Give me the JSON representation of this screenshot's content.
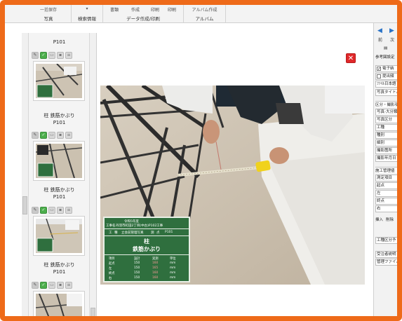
{
  "ribbon": {
    "photo_group": {
      "top": "一括保存",
      "label": "写真"
    },
    "search_group": {
      "top": "▾",
      "label": "検索情報"
    },
    "data_group": {
      "label": "データ作成/印刷",
      "buttons": [
        "書類",
        "作成",
        "印刷",
        "印刷"
      ]
    },
    "album_group": {
      "top": "アルバム作成",
      "label": "アルバム"
    }
  },
  "thumbnails": {
    "top_caption": "P101",
    "items": [
      {
        "title": "柱 鉄筋かぶり",
        "code": "P101"
      },
      {
        "title": "柱 鉄筋かぶり",
        "code": "P101"
      },
      {
        "title": "柱 鉄筋かぶり",
        "code": "P101"
      },
      {
        "title": "",
        "code": ""
      }
    ]
  },
  "viewer": {
    "close_symbol": "✕",
    "board": {
      "row1_label": "工事名",
      "row1_value": "令和5年度",
      "row1b_value": "丹羽市町田2丁目(中古)P102工事",
      "row2_a": "工",
      "row2_b": "種",
      "row2_c": "立会前管理写真",
      "row2_d": "測",
      "row2_e": "点",
      "row2_f": "P101",
      "title_main": "柱",
      "title_sub": "鉄筋かぶり",
      "table_head": [
        "項目",
        "設計",
        "実測",
        "単位"
      ],
      "table_rows": [
        [
          "起点",
          "150",
          "160",
          "mm"
        ],
        [
          "左",
          "150",
          "165",
          "mm"
        ],
        [
          "終点",
          "150",
          "160",
          "mm"
        ],
        [
          "右",
          "150",
          "160",
          "mm"
        ]
      ]
    }
  },
  "right_panel": {
    "prev_arrow": "◀",
    "next_arrow": "▶",
    "prev_label": "前",
    "next_label": "次",
    "ref_label": "参考図設定",
    "checkbox1": "電子納",
    "checkbox2": "提出頻",
    "file_name": "ﾌｧｲﾙ日本語",
    "photo_title": "写真タイトル",
    "section1": "区分・撮影項",
    "field1": "写真-大分類",
    "field2": "写真区分",
    "field3": "工種",
    "field4": "種別",
    "field5": "細別",
    "field6": "撮影箇所",
    "field7": "撮影年月日",
    "section2": "施工管理値",
    "field8": "測定項目",
    "field9": "起点",
    "field10": "左",
    "field11": "終点",
    "field12": "右",
    "insert_label": "挿入",
    "delete_label": "削除",
    "field13": "工種区分予",
    "field14": "受注者説明",
    "field15": "管理ファイル"
  },
  "colors": {
    "frame": "#ee6a19",
    "board": "#2f6f3e",
    "nav": "#2a73c7",
    "close": "#e0282a"
  }
}
